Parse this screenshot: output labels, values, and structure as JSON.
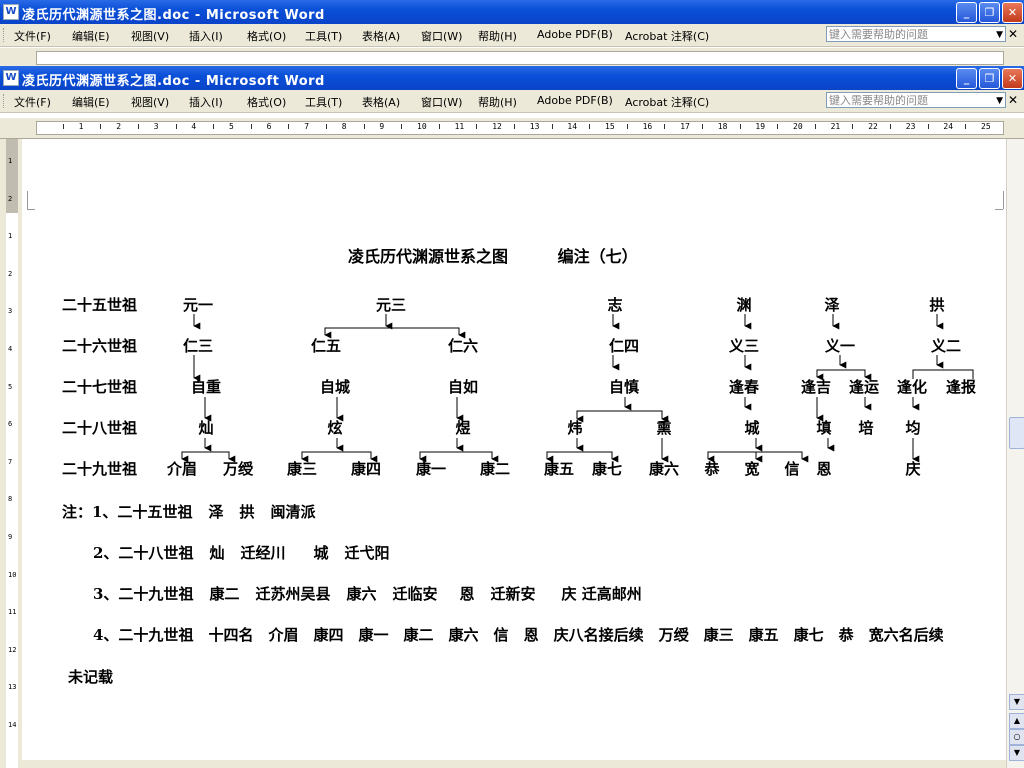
{
  "windows": [
    {
      "title": "凌氏历代渊源世系之图.doc - Microsoft Word",
      "icon": "W"
    },
    {
      "title": "凌氏历代渊源世系之图.doc - Microsoft Word",
      "icon": "W"
    }
  ],
  "window_buttons": {
    "minimize": "_",
    "restore": "❐",
    "close": "✕"
  },
  "menu": [
    "文件(F)",
    "编辑(E)",
    "视图(V)",
    "插入(I)",
    "格式(O)",
    "工具(T)",
    "表格(A)",
    "窗口(W)",
    "帮助(H)",
    "Adobe PDF(B)",
    "Acrobat 注释(C)"
  ],
  "help_placeholder": "键入需要帮助的问题",
  "ruler_numbers": [
    "1",
    "2",
    "3",
    "4",
    "5",
    "6",
    "7",
    "8",
    "9",
    "10",
    "11",
    "12",
    "13",
    "14",
    "15",
    "16",
    "17",
    "18",
    "19",
    "20",
    "21",
    "22",
    "23",
    "24",
    "25"
  ],
  "vruler_numbers": [
    "1",
    "2",
    "1",
    "2",
    "3",
    "4",
    "5",
    "6",
    "7",
    "8",
    "9",
    "10",
    "11",
    "12",
    "13",
    "14"
  ],
  "heading": {
    "title": "凌氏历代渊源世系之图",
    "subtitle": "编注（七）"
  },
  "generations": [
    "二十五世祖",
    "二十六世祖",
    "二十七世祖",
    "二十八世祖",
    "二十九世祖"
  ],
  "tree": {
    "g25": [
      "元一",
      "元三",
      "志",
      "渊",
      "泽",
      "拱"
    ],
    "g26": [
      "仁三",
      "仁五",
      "仁六",
      "仁四",
      "义三",
      "义一",
      "义二"
    ],
    "g27": [
      "自重",
      "自城",
      "自如",
      "自慎",
      "逢春",
      "逢吉",
      "逢运",
      "逢化",
      "逢报"
    ],
    "g28": [
      "灿",
      "炫",
      "煜",
      "炜",
      "熏",
      "城",
      "填",
      "培",
      "均"
    ],
    "g29": [
      "介眉",
      "万绶",
      "康三",
      "康四",
      "康一",
      "康二",
      "康五",
      "康七",
      "康六",
      "恭",
      "宽",
      "信",
      "恩",
      "庆"
    ]
  },
  "notes": [
    [
      "注：1、二十五世祖",
      "泽",
      "拱",
      "闽清派"
    ],
    [
      "2、二十八世祖",
      "灿",
      "迁经川",
      "城",
      "迁弋阳"
    ],
    [
      "3、二十九世祖",
      "康二",
      "迁苏州吴县",
      "康六",
      "迁临安",
      "恩",
      "迁新安",
      "庆 迁高邮州"
    ],
    [
      "4、二十九世祖",
      "十四名",
      "介眉",
      "康四",
      "康一",
      "康二",
      "康六",
      "信",
      "恩",
      "庆八名接后续",
      "万绶",
      "康三",
      "康五",
      "康七",
      "恭",
      "宽六名后续"
    ],
    [
      "未记载"
    ]
  ]
}
